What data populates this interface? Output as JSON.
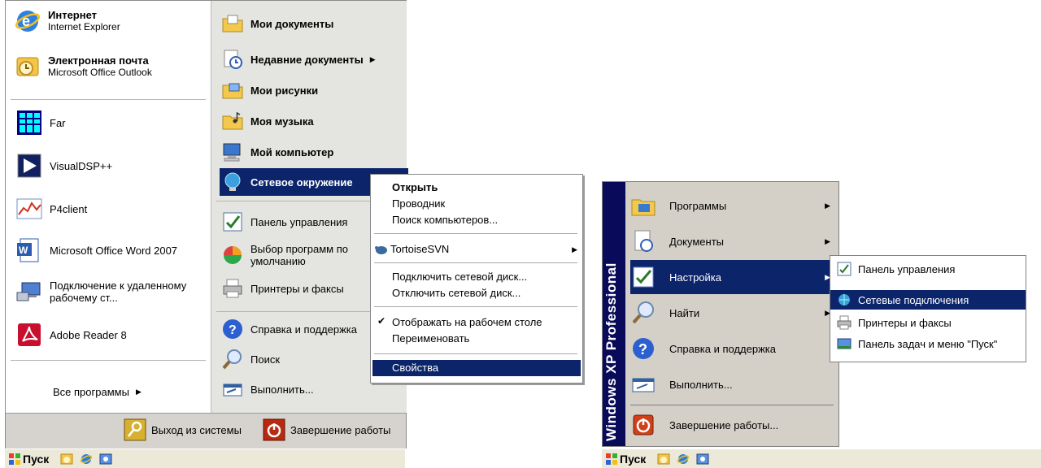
{
  "xp_menu": {
    "pinned": [
      {
        "title": "Интернет",
        "subtitle": "Internet Explorer"
      },
      {
        "title": "Электронная почта",
        "subtitle": "Microsoft Office Outlook"
      }
    ],
    "recent": [
      "Far",
      "VisualDSP++",
      "P4client",
      "Microsoft Office Word 2007",
      "Подключение к удаленному рабочему ст...",
      "Adobe Reader 8"
    ],
    "all_programs": "Все программы",
    "right": {
      "my_documents": "Мои документы",
      "recent_documents": "Недавние документы",
      "my_pictures": "Мои рисунки",
      "my_music": "Моя музыка",
      "my_computer": "Мой компьютер",
      "network": "Сетевое окружение",
      "control_panel": "Панель управления",
      "default_programs": "Выбор программ по умолчанию",
      "printers": "Принтеры и факсы",
      "help": "Справка и поддержка",
      "search": "Поиск",
      "run": "Выполнить..."
    },
    "logoff": "Выход из системы",
    "shutdown": "Завершение работы"
  },
  "context_menu": {
    "open": "Открыть",
    "explorer": "Проводник",
    "find_computers": "Поиск компьютеров...",
    "tortoise": "TortoiseSVN",
    "map_drive": "Подключить сетевой диск...",
    "disconnect_drive": "Отключить сетевой диск...",
    "show_on_desktop": "Отображать на рабочем столе",
    "rename": "Переименовать",
    "properties": "Свойства"
  },
  "taskbar": {
    "start": "Пуск"
  },
  "classic_menu": {
    "band": "Windows XP Professional",
    "items": [
      "Программы",
      "Документы",
      "Настройка",
      "Найти",
      "Справка и поддержка",
      "Выполнить...",
      "Завершение работы..."
    ],
    "submenu": [
      "Панель управления",
      "Сетевые подключения",
      "Принтеры и факсы",
      "Панель задач и меню \"Пуск\""
    ]
  },
  "colors": {
    "highlight": "#0b246a",
    "menu_face": "#d4d0c8",
    "xp_right": "#e4e4e0"
  }
}
